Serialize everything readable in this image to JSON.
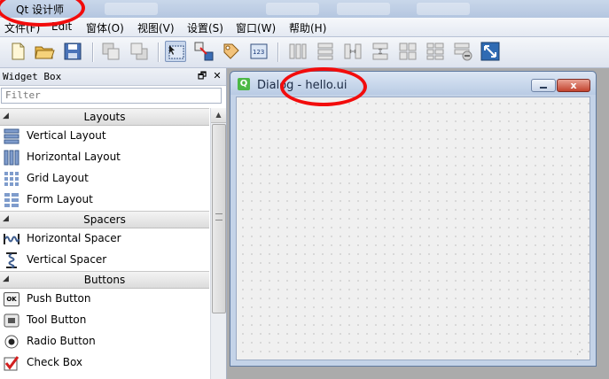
{
  "window": {
    "title": "Qt 设计师"
  },
  "menu": [
    {
      "label": "文件(F)"
    },
    {
      "label": "Edit"
    },
    {
      "label": "窗体(O)"
    },
    {
      "label": "视图(V)"
    },
    {
      "label": "设置(S)"
    },
    {
      "label": "窗口(W)"
    },
    {
      "label": "帮助(H)"
    }
  ],
  "toolbar": {
    "icons": [
      "new-file-icon",
      "open-folder-icon",
      "save-icon",
      "send-to-back-icon",
      "bring-to-front-icon",
      "edit-widgets-icon",
      "edit-signals-slots-icon",
      "edit-buddies-icon",
      "edit-tab-order-icon",
      "layout-horizontal-icon",
      "layout-vertical-icon",
      "layout-horizontal-splitter-icon",
      "layout-vertical-splitter-icon",
      "layout-grid-icon",
      "layout-form-icon",
      "break-layout-icon",
      "adjust-size-icon"
    ]
  },
  "widget_box": {
    "title": "Widget Box",
    "float_glyph": "🗗",
    "close_glyph": "✕",
    "filter_placeholder": "Filter",
    "categories": [
      {
        "label": "Layouts",
        "items": [
          {
            "label": "Vertical Layout",
            "icon": "vertical-layout-icon"
          },
          {
            "label": "Horizontal Layout",
            "icon": "horizontal-layout-icon"
          },
          {
            "label": "Grid Layout",
            "icon": "grid-layout-icon"
          },
          {
            "label": "Form Layout",
            "icon": "form-layout-icon"
          }
        ]
      },
      {
        "label": "Spacers",
        "items": [
          {
            "label": "Horizontal Spacer",
            "icon": "horizontal-spacer-icon"
          },
          {
            "label": "Vertical Spacer",
            "icon": "vertical-spacer-icon"
          }
        ]
      },
      {
        "label": "Buttons",
        "items": [
          {
            "label": "Push Button",
            "icon": "push-button-icon",
            "glyph": "OK"
          },
          {
            "label": "Tool Button",
            "icon": "tool-button-icon"
          },
          {
            "label": "Radio Button",
            "icon": "radio-button-icon"
          },
          {
            "label": "Check Box",
            "icon": "check-box-icon"
          }
        ]
      }
    ]
  },
  "dialog": {
    "title": "Dialog - hello.ui",
    "close_glyph": "x"
  },
  "colors": {
    "annotation": "#f20c0c",
    "window_frame": "#c4d3e8",
    "canvas": "#f0f0f0"
  }
}
